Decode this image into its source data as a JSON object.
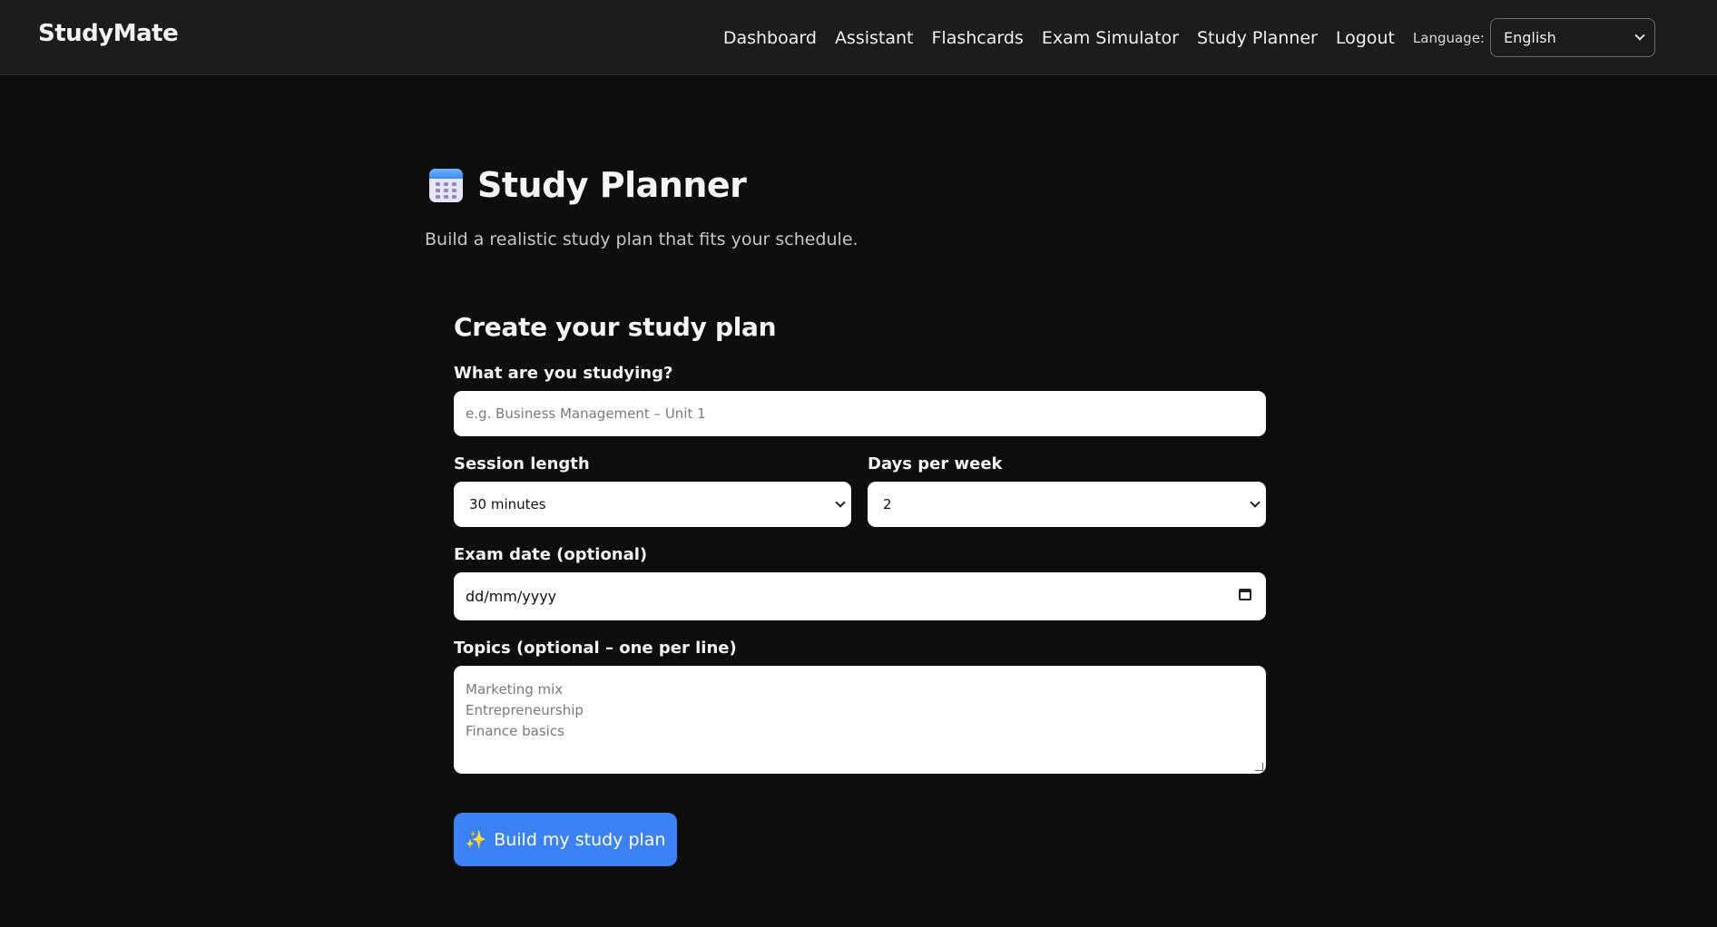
{
  "app": {
    "brand": "StudyMate"
  },
  "nav": {
    "links": [
      "Dashboard",
      "Assistant",
      "Flashcards",
      "Exam Simulator",
      "Study Planner",
      "Logout"
    ],
    "language_label": "Language:",
    "language_value": "English"
  },
  "page": {
    "icon": "calendar-icon",
    "title": "Study Planner",
    "subtitle": "Build a realistic study plan that fits your schedule."
  },
  "form": {
    "title": "Create your study plan",
    "subject_label": "What are you studying?",
    "subject_placeholder": "e.g. Business Management – Unit 1",
    "session_label": "Session length",
    "session_value": "30 minutes",
    "days_label": "Days per week",
    "days_value": "2",
    "exam_label": "Exam date (optional)",
    "exam_placeholder": "dd/mm/yyyy",
    "topics_label": "Topics (optional – one per line)",
    "topics_placeholder": [
      "Marketing mix",
      "Entrepreneurship",
      "Finance basics"
    ],
    "submit_label": "Build my study plan",
    "submit_icon": "sparkles-icon"
  },
  "colors": {
    "background": "#0d0d0d",
    "topbar": "#1c1c1c",
    "accent": "#3b82f6"
  }
}
